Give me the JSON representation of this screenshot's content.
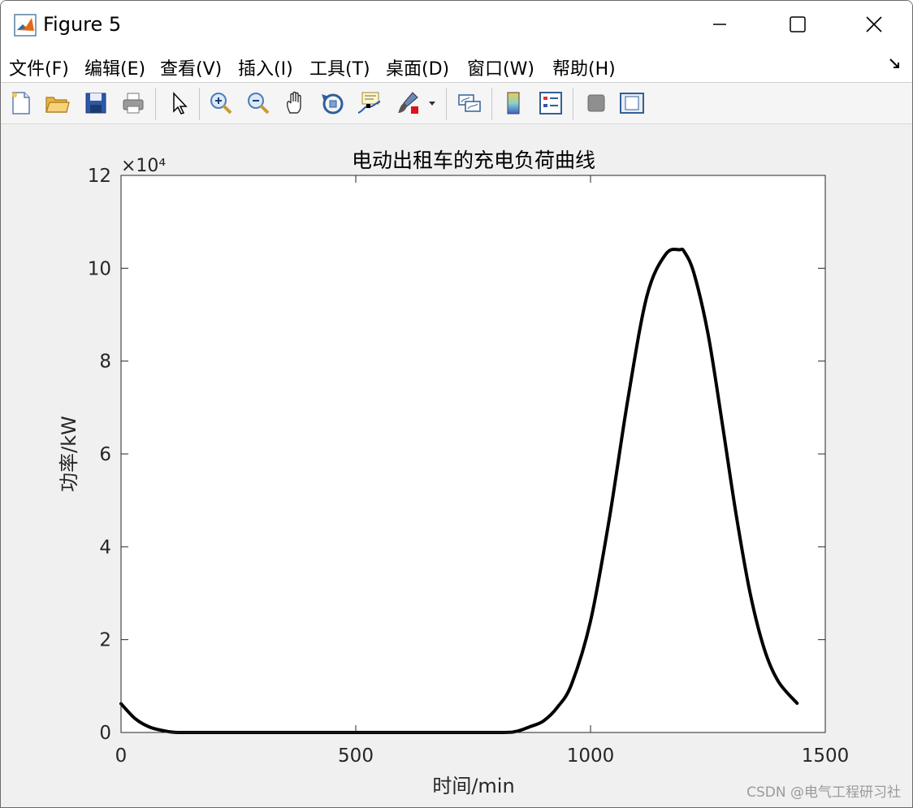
{
  "window": {
    "title": "Figure 5"
  },
  "menu": {
    "items": [
      "文件(F)",
      "编辑(E)",
      "查看(V)",
      "插入(I)",
      "工具(T)",
      "桌面(D)",
      "窗口(W)",
      "帮助(H)"
    ]
  },
  "toolbar": {
    "icons": [
      "new-figure-icon",
      "open-file-icon",
      "save-icon",
      "print-icon",
      "pointer-icon",
      "zoom-in-icon",
      "zoom-out-icon",
      "pan-icon",
      "rotate-3d-icon",
      "data-cursor-icon",
      "brush-icon",
      "brush-dropdown-icon",
      "link-plot-icon",
      "colorbar-icon",
      "legend-icon",
      "hide-plot-tools-icon",
      "show-plot-tools-icon"
    ]
  },
  "watermark": "CSDN @电气工程研习社",
  "chart_data": {
    "type": "line",
    "title": "电动出租车的充电负荷曲线",
    "xlabel": "时间/min",
    "ylabel": "功率/kW",
    "y_exponent_label": "×10⁴",
    "xlim": [
      0,
      1500
    ],
    "ylim": [
      0,
      12
    ],
    "xticks": [
      0,
      500,
      1000,
      1500
    ],
    "yticks": [
      0,
      2,
      4,
      6,
      8,
      10,
      12
    ],
    "grid": false,
    "line_color": "#000000",
    "series": [
      {
        "x": [
          0,
          30,
          60,
          90,
          120,
          200,
          400,
          600,
          800,
          840,
          870,
          900,
          930,
          960,
          1000,
          1040,
          1080,
          1120,
          1160,
          1190,
          1200,
          1220,
          1250,
          1280,
          1310,
          1340,
          1370,
          1400,
          1440
        ],
        "values": [
          0.62,
          0.3,
          0.12,
          0.04,
          0.0,
          0.0,
          0.0,
          0.0,
          0.0,
          0.02,
          0.12,
          0.25,
          0.55,
          1.05,
          2.4,
          4.6,
          7.2,
          9.4,
          10.3,
          10.4,
          10.35,
          9.9,
          8.6,
          6.7,
          4.7,
          3.0,
          1.8,
          1.1,
          0.63
        ]
      }
    ]
  }
}
